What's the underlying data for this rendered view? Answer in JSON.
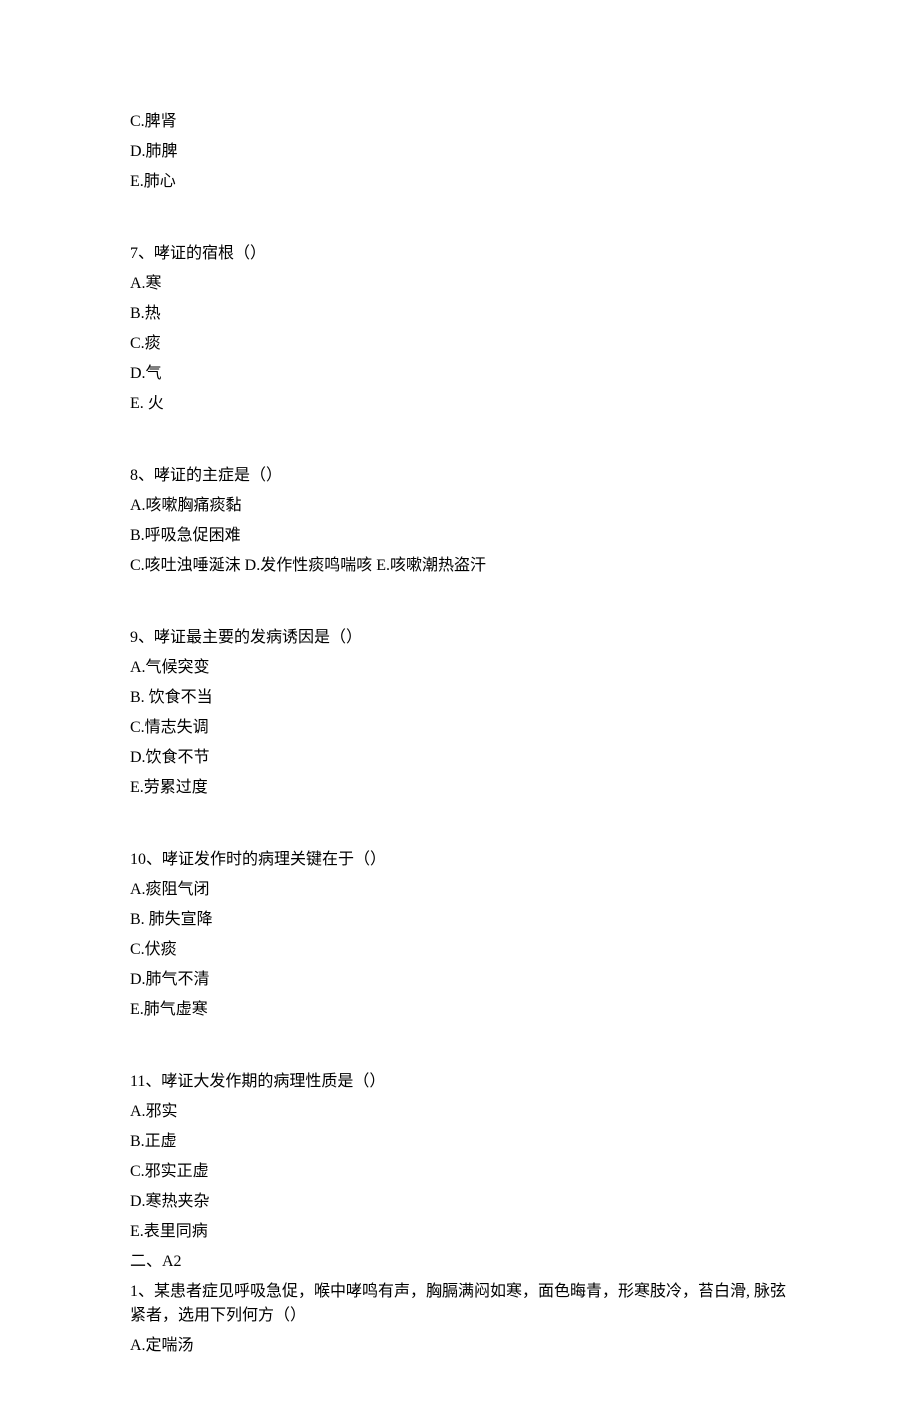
{
  "intro_options": [
    "C.脾肾",
    "D.肺脾",
    "E.肺心"
  ],
  "questions": [
    {
      "stem": "7、哮证的宿根（）",
      "options": [
        "A.寒",
        "B.热",
        "C.痰",
        "D.气",
        "E. 火"
      ]
    },
    {
      "stem": "8、哮证的主症是（）",
      "options": [
        "A.咳嗽胸痛痰黏",
        "B.呼吸急促困难",
        "C.咳吐浊唾涎沫 D.发作性痰鸣喘咳 E.咳嗽潮热盗汗"
      ]
    },
    {
      "stem": "9、哮证最主要的发病诱因是（）",
      "options": [
        "A.气候突变",
        "B. 饮食不当",
        "C.情志失调",
        "D.饮食不节",
        "E.劳累过度"
      ]
    },
    {
      "stem": "10、哮证发作时的病理关键在于（）",
      "options": [
        "A.痰阻气闭",
        "B. 肺失宣降",
        "C.伏痰",
        "D.肺气不清",
        "E.肺气虚寒"
      ]
    },
    {
      "stem": "11、哮证大发作期的病理性质是（）",
      "options": [
        "A.邪实",
        "B.正虚",
        "C.邪实正虚",
        "D.寒热夹杂",
        "E.表里同病"
      ]
    }
  ],
  "section2_heading": "二、A2",
  "section2_q1_stem": "1、某患者症见呼吸急促，喉中哮鸣有声，胸膈满闷如寒，面色晦青，形寒肢冷，苔白滑, 脉弦紧者，选用下列何方（）",
  "section2_q1_options": [
    "A.定喘汤"
  ]
}
